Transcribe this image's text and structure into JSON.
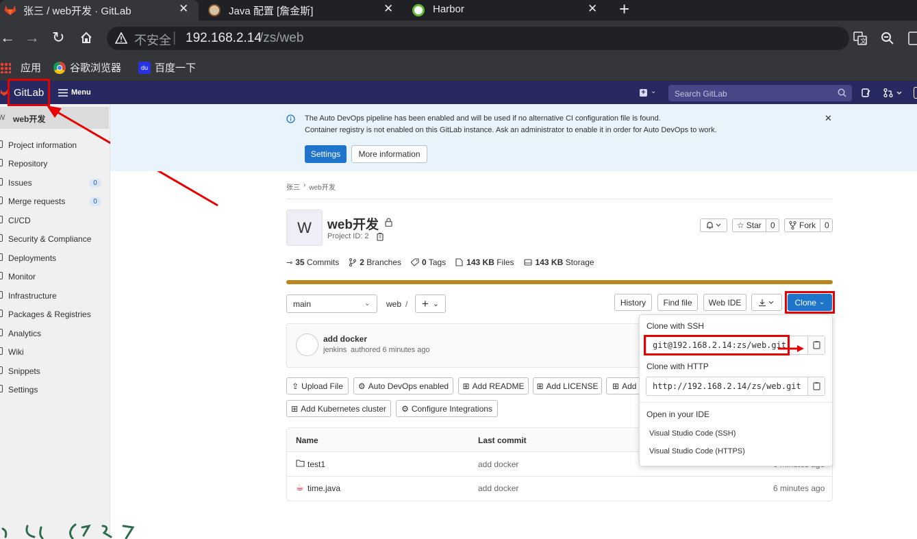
{
  "browser": {
    "tabs": [
      {
        "title": "张三 / web开发 · GitLab"
      },
      {
        "title": "Java 配置 [詹金斯]"
      },
      {
        "title": "Harbor"
      }
    ],
    "new_tab": "+",
    "security_label": "不安全",
    "url_host": "192.168.2.14",
    "url_path": "/zs/web",
    "bookmarks": [
      "应用",
      "谷歌浏览器",
      "百度一下"
    ]
  },
  "colors": {
    "gitlab_nav": "#292961",
    "primary": "#1f75cb",
    "banner": "#e9f3fc",
    "annotation_red": "#e60000",
    "progress": "#b8861b"
  },
  "gitlab_nav": {
    "logo": "GitLab",
    "menu": "Menu",
    "search_placeholder": "Search GitLab"
  },
  "sidebar": {
    "project_avatar": "W",
    "project_name": "web开发",
    "items": [
      {
        "label": "Project information"
      },
      {
        "label": "Repository"
      },
      {
        "label": "Issues",
        "badge": "0"
      },
      {
        "label": "Merge requests",
        "badge": "0"
      },
      {
        "label": "CI/CD"
      },
      {
        "label": "Security & Compliance"
      },
      {
        "label": "Deployments"
      },
      {
        "label": "Monitor"
      },
      {
        "label": "Infrastructure"
      },
      {
        "label": "Packages & Registries"
      },
      {
        "label": "Analytics"
      },
      {
        "label": "Wiki"
      },
      {
        "label": "Snippets"
      },
      {
        "label": "Settings"
      }
    ]
  },
  "banner": {
    "line1": "The Auto DevOps pipeline has been enabled and will be used if no alternative CI configuration file is found.",
    "line2": "Container registry is not enabled on this GitLab instance. Ask an administrator to enable it in order for Auto DevOps to work.",
    "settings_btn": "Settings",
    "more_info_btn": "More information"
  },
  "breadcrumb": {
    "owner": "张三",
    "sep": "›",
    "project": "web开发"
  },
  "project": {
    "avatar": "W",
    "name": "web开发",
    "id_label": "Project ID: 2",
    "star_label": "Star",
    "star_count": "0",
    "fork_label": "Fork",
    "fork_count": "0",
    "stats": {
      "commits_num": "35",
      "commits_label": "Commits",
      "branches_num": "2",
      "branches_label": "Branches",
      "tags_num": "0",
      "tags_label": "Tags",
      "files_num": "143 KB",
      "files_label": "Files",
      "storage_num": "143 KB",
      "storage_label": "Storage"
    }
  },
  "repo": {
    "branch": "main",
    "path": "web",
    "path_sep": "/",
    "history": "History",
    "find_file": "Find file",
    "web_ide": "Web IDE",
    "clone": "Clone"
  },
  "commit": {
    "title": "add docker",
    "author": "jenkins",
    "meta": "authored 6 minutes ago"
  },
  "actions": {
    "upload": "Upload File",
    "autodevops": "Auto DevOps enabled",
    "readme": "Add README",
    "license": "Add LICENSE",
    "add_more": "Add",
    "k8s": "Add Kubernetes cluster",
    "integrations": "Configure Integrations"
  },
  "table": {
    "headers": [
      "Name",
      "Last commit"
    ],
    "rows": [
      {
        "name": "test1",
        "commit": "add docker",
        "time": "6 minutes ago"
      },
      {
        "name": "time.java",
        "commit": "add docker",
        "time": "6 minutes ago"
      }
    ]
  },
  "clone_dropdown": {
    "ssh_label": "Clone with SSH",
    "ssh_url": "git@192.168.2.14:zs/web.git",
    "http_label": "Clone with HTTP",
    "http_url": "http://192.168.2.14/zs/web.git",
    "ide_header": "Open in your IDE",
    "ide_ssh": "Visual Studio Code (SSH)",
    "ide_https": "Visual Studio Code (HTTPS)"
  }
}
